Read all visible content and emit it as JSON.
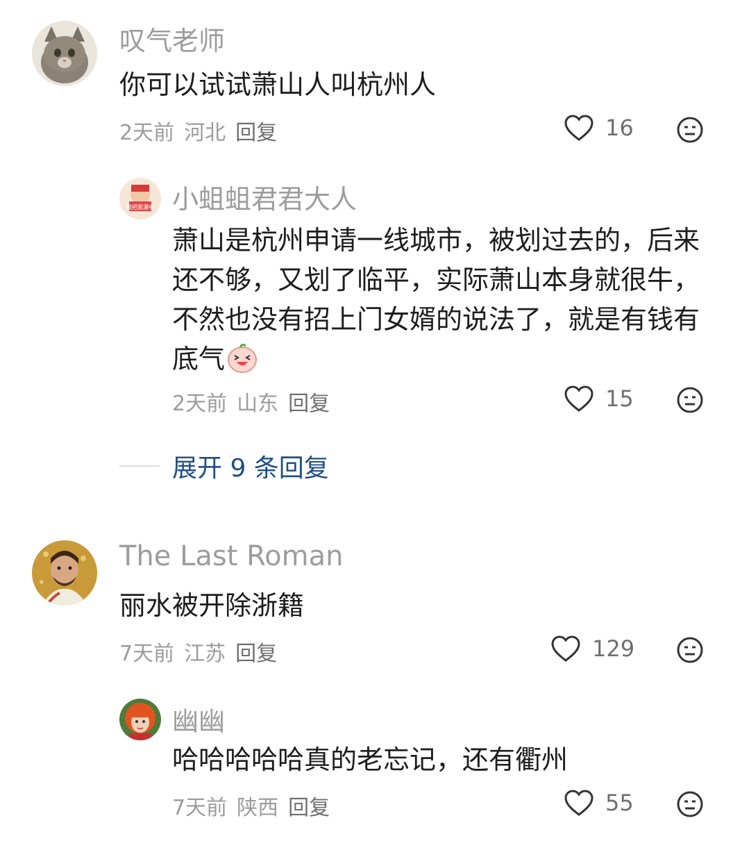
{
  "comments": [
    {
      "user": "叹气老师",
      "text": "你可以试试萧山人叫杭州人",
      "time": "2天前",
      "location": "河北",
      "reply_label": "回复",
      "likes": "16"
    },
    {
      "user": "小蛆蛆君君大人",
      "text": "萧山是杭州申请一线城市，被划过去的，后来还不够，又划了临平，实际萧山本身就很牛，不然也没有招上门女婿的说法了，就是有钱有底气",
      "avatar_caption": "我把我瀑啦",
      "time": "2天前",
      "location": "山东",
      "reply_label": "回复",
      "likes": "15"
    },
    {
      "user": "The Last Roman",
      "text": "丽水被开除浙籍",
      "time": "7天前",
      "location": "江苏",
      "reply_label": "回复",
      "likes": "129"
    },
    {
      "user": "幽幽",
      "text": "哈哈哈哈哈真的老忘记，还有衢州",
      "time": "7天前",
      "location": "陕西",
      "reply_label": "回复",
      "likes": "55"
    }
  ],
  "expand_replies": "展开 9 条回复",
  "colors": {
    "username": "#9c9c9c",
    "text": "#1d1d1d",
    "meta": "#9c9c9c",
    "link": "#1f4e86"
  },
  "icons": [
    "heart-icon",
    "dislike-face-icon",
    "laughing-emoji-icon"
  ]
}
